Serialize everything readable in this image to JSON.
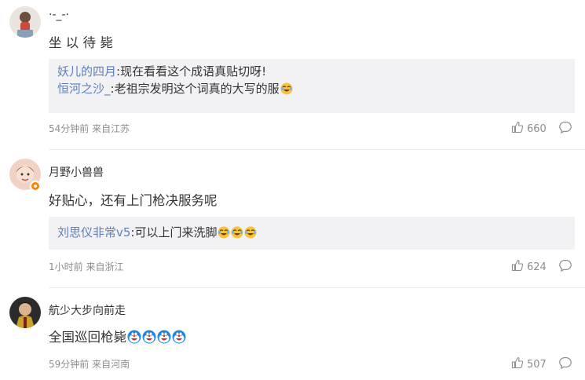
{
  "comments": [
    {
      "username": "·-_-·",
      "content": "坐 以 待 毙",
      "replies": [
        {
          "user": "妖儿的四月",
          "text": ":现在看看这个成语真贴切呀!",
          "emoji": []
        },
        {
          "user": "恒河之沙_",
          "text": ":老祖宗发明这个词真的大写的服",
          "emoji": [
            "laugh-cry-emoji"
          ]
        }
      ],
      "time": "54分钟前",
      "source": "来自江苏",
      "likes": "660",
      "content_emoji": []
    },
    {
      "username": "月野小兽兽",
      "content": "好贴心，还有上门枪决服务呢",
      "replies": [
        {
          "user": "刘思仪非常v5",
          "text": ":可以上门来洗脚",
          "emoji": [
            "laugh-cry-emoji",
            "laugh-cry-emoji",
            "laugh-cry-emoji"
          ]
        }
      ],
      "time": "1小时前",
      "source": "来自浙江",
      "likes": "624",
      "content_emoji": []
    },
    {
      "username": "航少大步向前走",
      "content": "全国巡回枪毙",
      "replies": [],
      "time": "59分钟前",
      "source": "来自河南",
      "likes": "507",
      "content_emoji": [
        "doraemon-emoji",
        "doraemon-emoji",
        "doraemon-emoji",
        "doraemon-emoji"
      ]
    }
  ],
  "colors": {
    "reply_user": "#5b7fb9",
    "reply_bg": "#f2f2f5",
    "meta": "#8d8d8d",
    "badge": "#ff8200"
  }
}
